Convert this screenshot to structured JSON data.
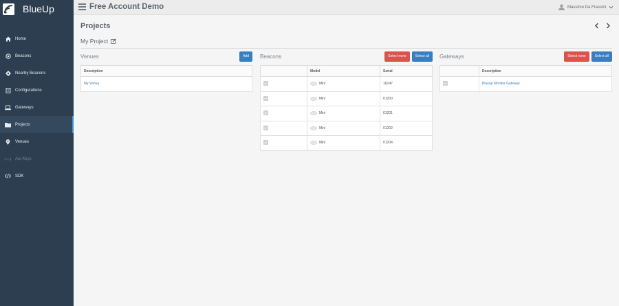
{
  "app": {
    "brand": "BlueUp",
    "title": "Free Account Demo"
  },
  "user": {
    "name": "Massimo Da Frassini"
  },
  "colors": {
    "sidebar": "#2c3e50",
    "accent": "#3a7ec2",
    "danger": "#d9534f",
    "active_marker": "#3d8fd6"
  },
  "nav": [
    {
      "label": "Home",
      "icon": "home-icon"
    },
    {
      "label": "Beacons",
      "icon": "beacon-icon"
    },
    {
      "label": "Nearby Beacons",
      "icon": "nearby-icon"
    },
    {
      "label": "Configurations",
      "icon": "configurations-icon"
    },
    {
      "label": "Gateways",
      "icon": "laptop-icon"
    },
    {
      "label": "Projects",
      "icon": "folder-icon"
    },
    {
      "label": "Venues",
      "icon": "map-pin-icon"
    },
    {
      "label": "Api Keys",
      "icon": "key-icon"
    },
    {
      "label": "SDK",
      "icon": "code-icon"
    }
  ],
  "page": {
    "title": "Projects",
    "project_name": "My Project"
  },
  "venues": {
    "title": "Venues",
    "add_label": "Add",
    "header": "Description",
    "rows": [
      "My Venue"
    ]
  },
  "beacons": {
    "title": "Beacons",
    "select_none_label": "Select none",
    "select_all_label": "Select all",
    "headers": [
      "",
      "Model",
      "Serial"
    ],
    "rows": [
      {
        "model": "Mini",
        "serial": "16247"
      },
      {
        "model": "Mini",
        "serial": "01200"
      },
      {
        "model": "Mini",
        "serial": "01201"
      },
      {
        "model": "Mini",
        "serial": "01202"
      },
      {
        "model": "Mini",
        "serial": "01204"
      }
    ]
  },
  "gateways": {
    "title": "Gateways",
    "select_none_label": "Select none",
    "select_all_label": "Select all",
    "headers": [
      "",
      "Description"
    ],
    "rows": [
      {
        "description": "Blueup Monitor Gateway"
      }
    ]
  }
}
